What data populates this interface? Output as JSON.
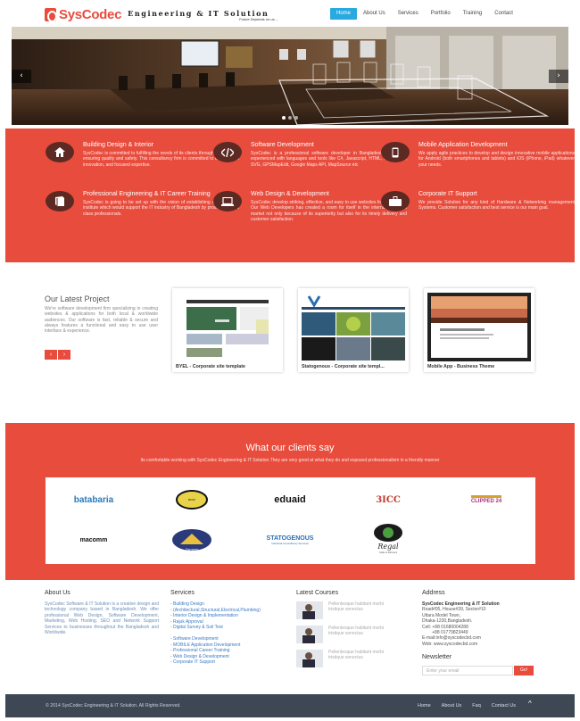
{
  "brand": {
    "name": "SysCodec",
    "sub": "Engineering & IT Solution",
    "tagline": "Future Depends on us....",
    "accent": "#e84c3d",
    "nav_active": "#28a9e0"
  },
  "nav": [
    {
      "label": "Home"
    },
    {
      "label": "About Us"
    },
    {
      "label": "Services"
    },
    {
      "label": "Portfolio"
    },
    {
      "label": "Training"
    },
    {
      "label": "Contact"
    }
  ],
  "hero": {
    "prev": "‹",
    "next": "›"
  },
  "services": [
    {
      "title": "Building Design & Interior",
      "icon": "home-icon",
      "desc": "SysCodec is committed to fulfilling the needs of its clients through saving cost, ensuring quality and safety. This consultancy firm is committed to do technical innovation, and focused expertise."
    },
    {
      "title": "Software Development",
      "icon": "code-icon",
      "desc": "SysCodec is a professional software developer in Bangladesh. Our team experienced with languages and tools like C#, Javascript, HTML, XML, .NET, SVG, GPSMapEdit, Google Maps API, MapSource etc"
    },
    {
      "title": "Mobile Application Development",
      "icon": "mobile-icon",
      "desc": "We apply agile practices to develop and design innovative mobile applications for Android (both smartphones and tablets) and iOS (iPhone, iPad) whatever your needs."
    },
    {
      "title": "Professional Engineering & IT Career Training",
      "icon": "book-icon",
      "desc": "SysCodec is going to be set up with the vision of establishing a world class institute which would support the IT industry of Bangladesh by producing world class professionals."
    },
    {
      "title": "Web Design & Development",
      "icon": "laptop-icon",
      "desc": "SysCodec develop striking, effective, and easy to use websites for all budgets. Our Web Developers has created a room for itself in the international Web market not only because of its superiority but also for its timely delivery and customer satisfaction."
    },
    {
      "title": "Corporate IT Support",
      "icon": "briefcase-icon",
      "desc": "We provide Solution for any kind of Hardware & Networking management Systems. Customer satisfaction and best service is our main goal."
    }
  ],
  "projects": {
    "title": "Our Latest Project",
    "desc": "We're software development firm specializing in creating websites & applications for both local & worldwide audiences. Our software is fast, reliable & secure and always features a functional and easy to use user interface & experience.",
    "prev": "‹",
    "next": "›",
    "items": [
      {
        "caption": "BYEL - Corporate site template"
      },
      {
        "caption": "Statogenous - Corporate site templ..."
      },
      {
        "caption": "Mobile App - Business Theme"
      }
    ]
  },
  "clients": {
    "title": "What our clients say",
    "subtitle": "Its comfortable working with SysCodec Engineering & IT Solution.They are very good at what they do and exposed professionalism in a friendly manner",
    "logos": [
      {
        "name": "batabaria"
      },
      {
        "name": "BKSP"
      },
      {
        "name": "eduaid"
      },
      {
        "name": "3ICC"
      },
      {
        "name": "CLIPPED 24"
      },
      {
        "name": "macomm"
      },
      {
        "name": "Zameen"
      },
      {
        "name": "STATOGENOUS",
        "tag": "Industrial Consultancy Services"
      },
      {
        "name": "Regal",
        "tag": "Cafe & Dinners"
      }
    ]
  },
  "footer": {
    "about": {
      "title": "About Us",
      "text": "SysCodec Software & IT Solution is a creative design and technology company based in Bangladesh. We offer professional Web Design, Software Development, Marketing, Web Hosting, SEO and Network Support Services to businesses throughout the Bangladesh and Worldwide."
    },
    "services": {
      "title": "Services",
      "items": [
        "- Building Design",
        "- (Architectural,Structural,Electrical,Plumbing)",
        "- Interior Design & Implementation",
        "- Rajuk Approval",
        "- Digital Survey & Soil Test",
        "- Software Development",
        "- MOBILE Application Development",
        "- Professional Career Training",
        "- Web Design & Development",
        "- Corporate IT Support"
      ]
    },
    "courses": {
      "title": "Latest Courses",
      "items": [
        {
          "text": "Pellentesque habitant morbi tristique senectus"
        },
        {
          "text": "Pellentesque habitant morbi tristique senectus"
        },
        {
          "text": "Pellentesque habitant morbi tristique senectus"
        }
      ]
    },
    "address": {
      "title": "Address",
      "lines": [
        "SysCodec Engineering & IT Solution",
        "Road#05, House#39, Sector#10",
        "Uttara Model Town,",
        "Dhaka-1230,Bangladesh.",
        "Cell: +88 01680004288",
        "        +88 01779823449",
        "E-mail:info@syscodecbd.com",
        "Web: www.syscodecbd.com"
      ]
    },
    "newsletter": {
      "title": "Newsletter",
      "placeholder": "Enter your email",
      "button": "Go!"
    },
    "copyright": "© 2014 SysCodec Engineering & IT Solution. All Rights Reserved.",
    "nav": [
      {
        "label": "Home"
      },
      {
        "label": "About Us"
      },
      {
        "label": "Faq"
      },
      {
        "label": "Contact Us"
      }
    ],
    "up": "^"
  }
}
